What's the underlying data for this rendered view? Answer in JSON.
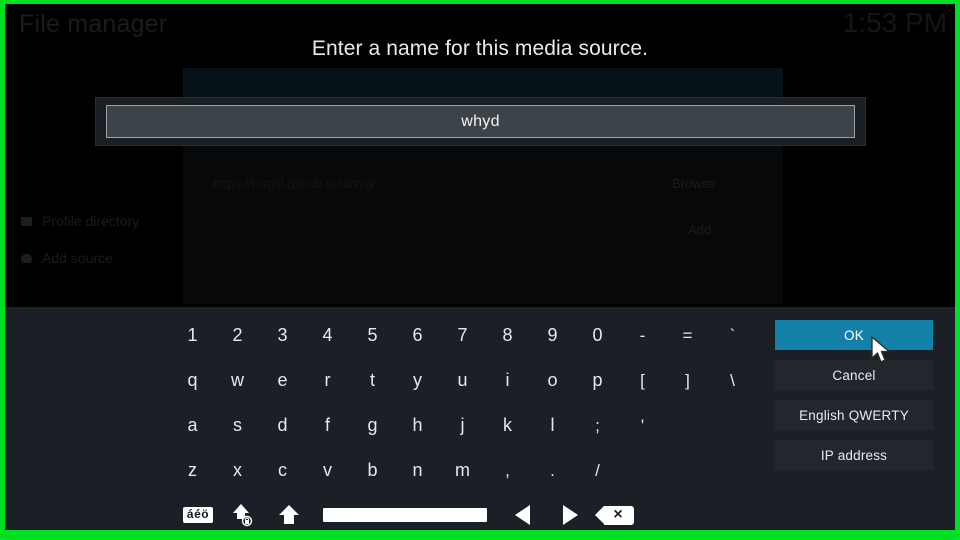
{
  "window": {
    "app_title": "File manager",
    "clock": "1:53 PM"
  },
  "background": {
    "url_value": "https://mrgsi.github.io/dirtyg/",
    "browse_label": "Browse",
    "add_label": "Add",
    "dim_pair": ". .",
    "sidebar": [
      {
        "label": "Profile directory",
        "icon": "folder-icon"
      },
      {
        "label": "Add source",
        "icon": "add-source-icon"
      }
    ]
  },
  "dialog": {
    "prompt": "Enter a name for this media source.",
    "input_value": "whyd",
    "input_placeholder": ""
  },
  "keyboard": {
    "rows": [
      [
        "1",
        "2",
        "3",
        "4",
        "5",
        "6",
        "7",
        "8",
        "9",
        "0",
        "-",
        "=",
        "`"
      ],
      [
        "q",
        "w",
        "e",
        "r",
        "t",
        "y",
        "u",
        "i",
        "o",
        "p",
        "[",
        "]",
        "\\"
      ],
      [
        "a",
        "s",
        "d",
        "f",
        "g",
        "h",
        "j",
        "k",
        "l",
        ";",
        "'"
      ],
      [
        "z",
        "x",
        "c",
        "v",
        "b",
        "n",
        "m",
        ",",
        ".",
        "/"
      ]
    ],
    "function_row": [
      {
        "name": "accents-key",
        "label": "áéö"
      },
      {
        "name": "capslock-key",
        "label": ""
      },
      {
        "name": "shift-key",
        "label": ""
      },
      {
        "name": "space-key",
        "label": ""
      },
      {
        "name": "cursor-left-key",
        "label": ""
      },
      {
        "name": "cursor-right-key",
        "label": ""
      },
      {
        "name": "backspace-key",
        "label": ""
      }
    ]
  },
  "actions": {
    "buttons": [
      {
        "label": "OK",
        "selected": true
      },
      {
        "label": "Cancel",
        "selected": false
      },
      {
        "label": "English QWERTY",
        "selected": false
      },
      {
        "label": "IP address",
        "selected": false
      }
    ]
  },
  "colors": {
    "accent": "#1380a8",
    "keyboard_bg": "#1b2027",
    "button_bg": "#22272e",
    "input_bg": "#3d4449",
    "capture_border": "#00e020"
  }
}
